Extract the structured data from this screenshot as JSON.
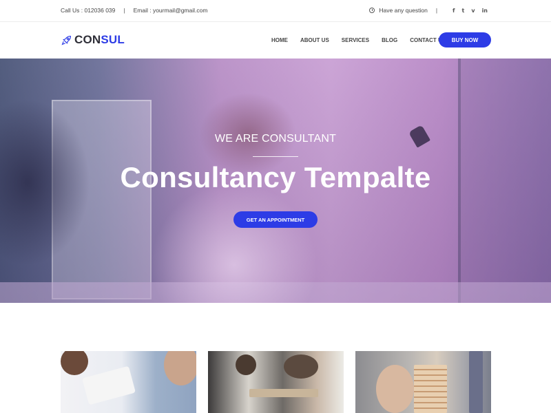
{
  "topbar": {
    "phone": "Call Us : 012036 039",
    "separator": "|",
    "email": "Email : yourmail@gmail.com",
    "question": "Have any question",
    "question_icon": "question-circle-icon",
    "social": [
      {
        "name": "facebook",
        "glyph": "f"
      },
      {
        "name": "twitter",
        "glyph": "t"
      },
      {
        "name": "vimeo",
        "glyph": "v"
      },
      {
        "name": "linkedin",
        "glyph": "in"
      }
    ]
  },
  "header": {
    "logo_icon": "rocket-icon",
    "logo_part1": "CON",
    "logo_part2": "SUL",
    "nav": [
      "HOME",
      "ABOUT US",
      "SERVICES",
      "BLOG",
      "CONTACT US"
    ],
    "buy_label": "BUY NOW"
  },
  "hero": {
    "subtitle": "WE ARE CONSULTANT",
    "title": "Consultancy Tempalte",
    "cta_label": "GET AN APPOINTMENT"
  },
  "cards": [
    {
      "image": "consultation-meeting-photo"
    },
    {
      "image": "team-discussion-photo"
    },
    {
      "image": "wooden-blocks-tower-photo"
    }
  ],
  "colors": {
    "accent": "#2d3ce6",
    "text_dark": "#2f2f38",
    "hero_overlay": "#c9a0d4"
  }
}
